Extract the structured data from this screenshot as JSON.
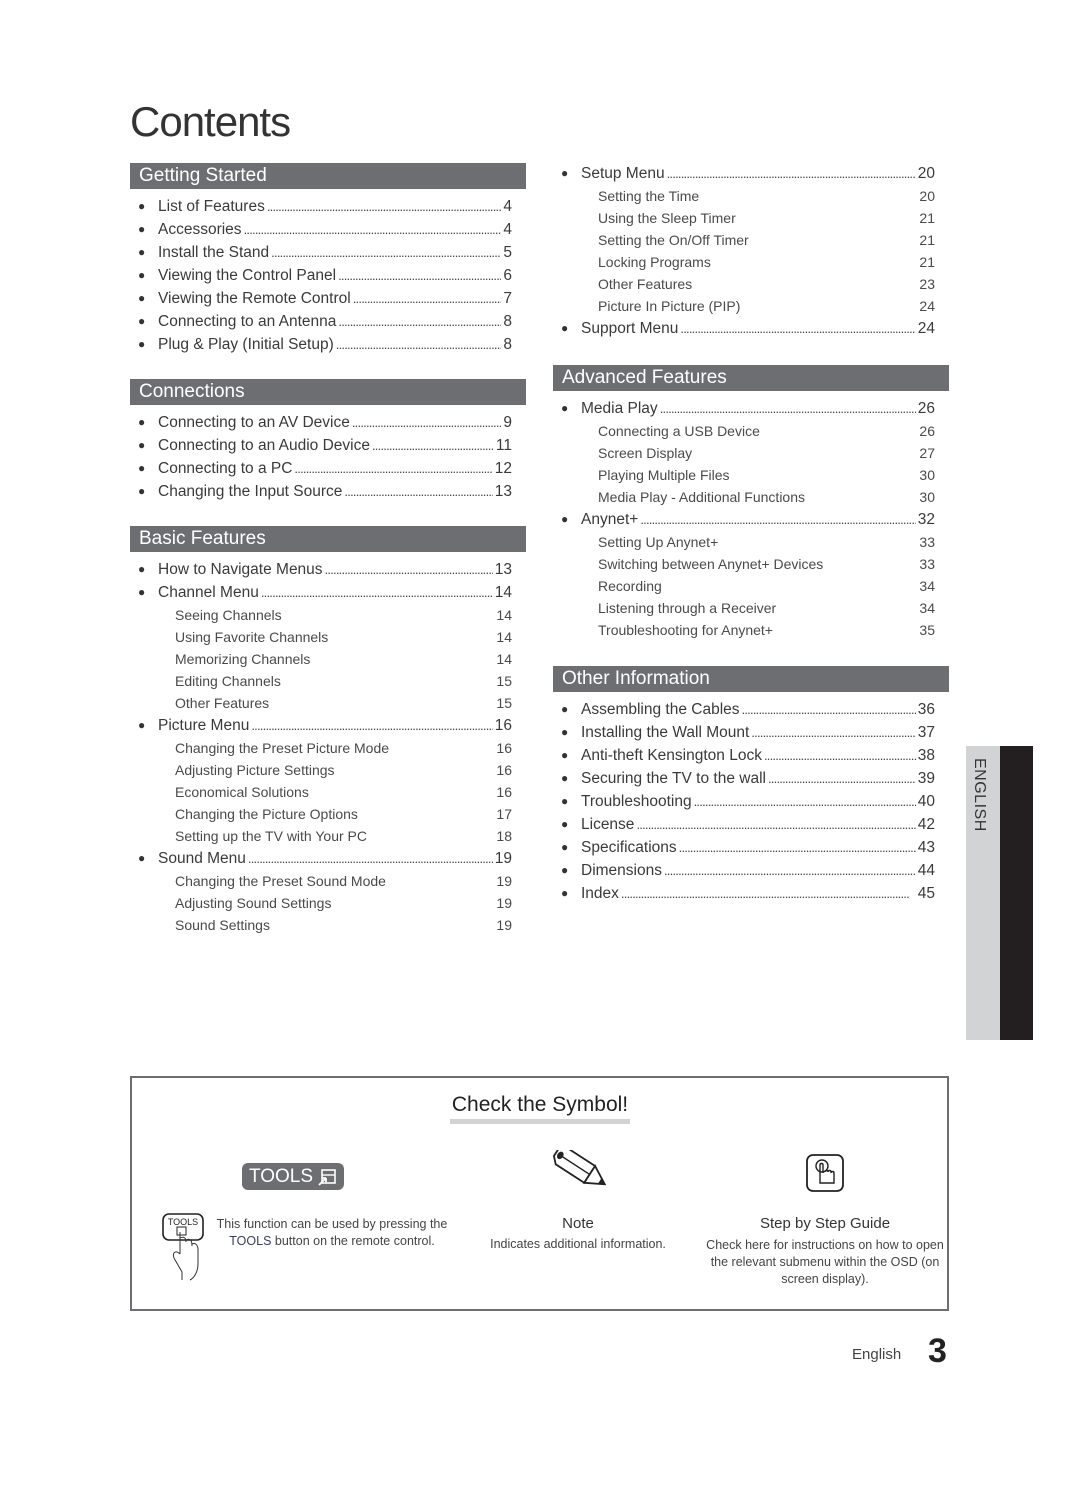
{
  "title": "Contents",
  "left_column": [
    {
      "header": "Getting Started",
      "entries": [
        {
          "title": "List of Features",
          "page": "4",
          "subs": []
        },
        {
          "title": "Accessories",
          "page": "4",
          "subs": []
        },
        {
          "title": "Install the Stand",
          "page": "5",
          "subs": []
        },
        {
          "title": "Viewing the Control Panel",
          "page": "6",
          "subs": []
        },
        {
          "title": "Viewing the Remote Control",
          "page": "7",
          "subs": []
        },
        {
          "title": "Connecting to an Antenna",
          "page": "8",
          "subs": []
        },
        {
          "title": "Plug & Play (Initial Setup)",
          "page": "8",
          "subs": []
        }
      ]
    },
    {
      "header": "Connections",
      "entries": [
        {
          "title": "Connecting to an AV Device",
          "page": "9",
          "subs": []
        },
        {
          "title": "Connecting to an Audio Device",
          "page": "11",
          "subs": []
        },
        {
          "title": "Connecting to a PC",
          "page": "12",
          "subs": []
        },
        {
          "title": "Changing the Input Source",
          "page": "13",
          "subs": []
        }
      ]
    },
    {
      "header": "Basic Features",
      "entries": [
        {
          "title": "How to Navigate Menus",
          "page": "13",
          "subs": []
        },
        {
          "title": "Channel Menu",
          "page": "14",
          "subs": [
            {
              "title": "Seeing Channels",
              "page": "14"
            },
            {
              "title": "Using Favorite Channels",
              "page": "14"
            },
            {
              "title": "Memorizing Channels",
              "page": "14"
            },
            {
              "title": "Editing Channels",
              "page": "15"
            },
            {
              "title": "Other Features",
              "page": "15"
            }
          ]
        },
        {
          "title": "Picture Menu",
          "page": "16",
          "subs": [
            {
              "title": "Changing the Preset Picture Mode",
              "page": "16"
            },
            {
              "title": "Adjusting Picture Settings",
              "page": "16"
            },
            {
              "title": "Economical Solutions",
              "page": "16"
            },
            {
              "title": "Changing the Picture Options",
              "page": "17"
            },
            {
              "title": "Setting up the TV with Your PC",
              "page": "18"
            }
          ]
        },
        {
          "title": "Sound Menu",
          "page": "19",
          "subs": [
            {
              "title": "Changing the Preset Sound Mode",
              "page": "19"
            },
            {
              "title": "Adjusting Sound Settings",
              "page": "19"
            },
            {
              "title": "Sound Settings",
              "page": "19"
            }
          ]
        }
      ]
    }
  ],
  "right_column": [
    {
      "header": "",
      "entries": [
        {
          "title": "Setup Menu",
          "page": "20",
          "subs": [
            {
              "title": "Setting the Time",
              "page": "20"
            },
            {
              "title": "Using the Sleep Timer",
              "page": "21"
            },
            {
              "title": "Setting the On/Off Timer",
              "page": "21"
            },
            {
              "title": "Locking Programs",
              "page": "21"
            },
            {
              "title": "Other Features",
              "page": "23"
            },
            {
              "title": "Picture In Picture (PIP)",
              "page": "24"
            }
          ]
        },
        {
          "title": "Support Menu",
          "page": "24",
          "subs": []
        }
      ]
    },
    {
      "header": "Advanced Features",
      "entries": [
        {
          "title": "Media Play",
          "page": "26",
          "subs": [
            {
              "title": "Connecting a USB Device",
              "page": "26"
            },
            {
              "title": "Screen Display",
              "page": "27"
            },
            {
              "title": "Playing Multiple Files",
              "page": "30"
            },
            {
              "title": "Media Play - Additional Functions",
              "page": "30"
            }
          ]
        },
        {
          "title": "Anynet+",
          "page": "32",
          "subs": [
            {
              "title": "Setting Up Anynet+",
              "page": "33"
            },
            {
              "title": "Switching between Anynet+ Devices",
              "page": "33"
            },
            {
              "title": "Recording",
              "page": "34"
            },
            {
              "title": "Listening through a Receiver",
              "page": "34"
            },
            {
              "title": "Troubleshooting for Anynet+",
              "page": "35"
            }
          ]
        }
      ]
    },
    {
      "header": "Other Information",
      "entries": [
        {
          "title": "Assembling the Cables",
          "page": "36",
          "subs": []
        },
        {
          "title": "Installing the Wall Mount",
          "page": "37",
          "subs": []
        },
        {
          "title": "Anti-theft Kensington Lock",
          "page": "38",
          "subs": []
        },
        {
          "title": "Securing the TV to the wall",
          "page": "39",
          "subs": []
        },
        {
          "title": "Troubleshooting",
          "page": "40",
          "subs": []
        },
        {
          "title": "License",
          "page": "42",
          "subs": []
        },
        {
          "title": "Specifications",
          "page": "43",
          "subs": []
        },
        {
          "title": "Dimensions",
          "page": "44",
          "subs": []
        },
        {
          "title": "Index",
          "page": "45",
          "subs": []
        }
      ]
    }
  ],
  "language_tab": "ENGLISH",
  "symbols": {
    "title": "Check the Symbol!",
    "tools": {
      "badge": "TOOLS",
      "remote_label": "TOOLS",
      "desc_before": "This function can be used by pressing the",
      "desc_keyword": "TOOLS",
      "desc_after": "button on the remote control."
    },
    "note": {
      "label": "Note",
      "desc": "Indicates additional information."
    },
    "guide": {
      "label": "Step by Step Guide",
      "desc": "Check here for instructions on how to open the relevant submenu within the OSD (on screen display)."
    }
  },
  "footer": {
    "language": "English",
    "page_number": "3"
  },
  "colors": {
    "section_header_bg": "#6d6e71",
    "language_tab_bg": "#d2d3d4",
    "language_tab_dark": "#231f20"
  }
}
